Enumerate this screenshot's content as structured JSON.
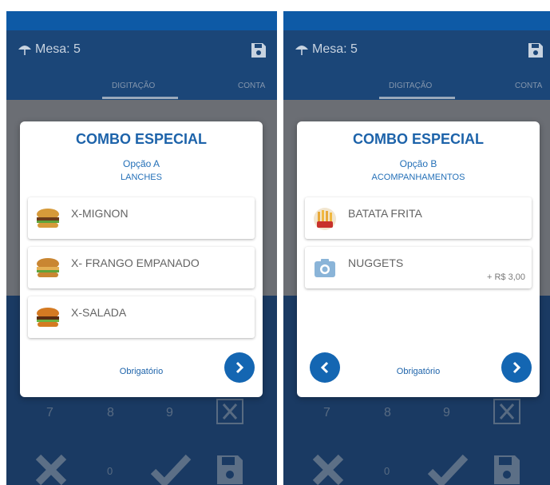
{
  "header": {
    "title": "Mesa: 5"
  },
  "tabs": {
    "active": "DIGITAÇÃO",
    "partial": "CONTA"
  },
  "keypad": {
    "k7": "7",
    "k8": "8",
    "k9": "9",
    "k0": "0"
  },
  "left_screen": {
    "modal": {
      "title": "COMBO ESPECIAL",
      "option": "Opção A",
      "category": "LANCHES",
      "items": [
        {
          "name": "X-MIGNON"
        },
        {
          "name": "X- FRANGO EMPANADO"
        },
        {
          "name": "X-SALADA"
        }
      ],
      "footer": "Obrigatório"
    }
  },
  "right_screen": {
    "modal": {
      "title": "COMBO ESPECIAL",
      "option": "Opção B",
      "category": "ACOMPANHAMENTOS",
      "items": [
        {
          "name": "BATATA FRITA"
        },
        {
          "name": "NUGGETS",
          "price": "+ R$ 3,00"
        }
      ],
      "footer": "Obrigatório"
    }
  },
  "colors": {
    "primary": "#1466b2",
    "appbar": "#1b4678",
    "statusbar": "#0e5aa6"
  }
}
